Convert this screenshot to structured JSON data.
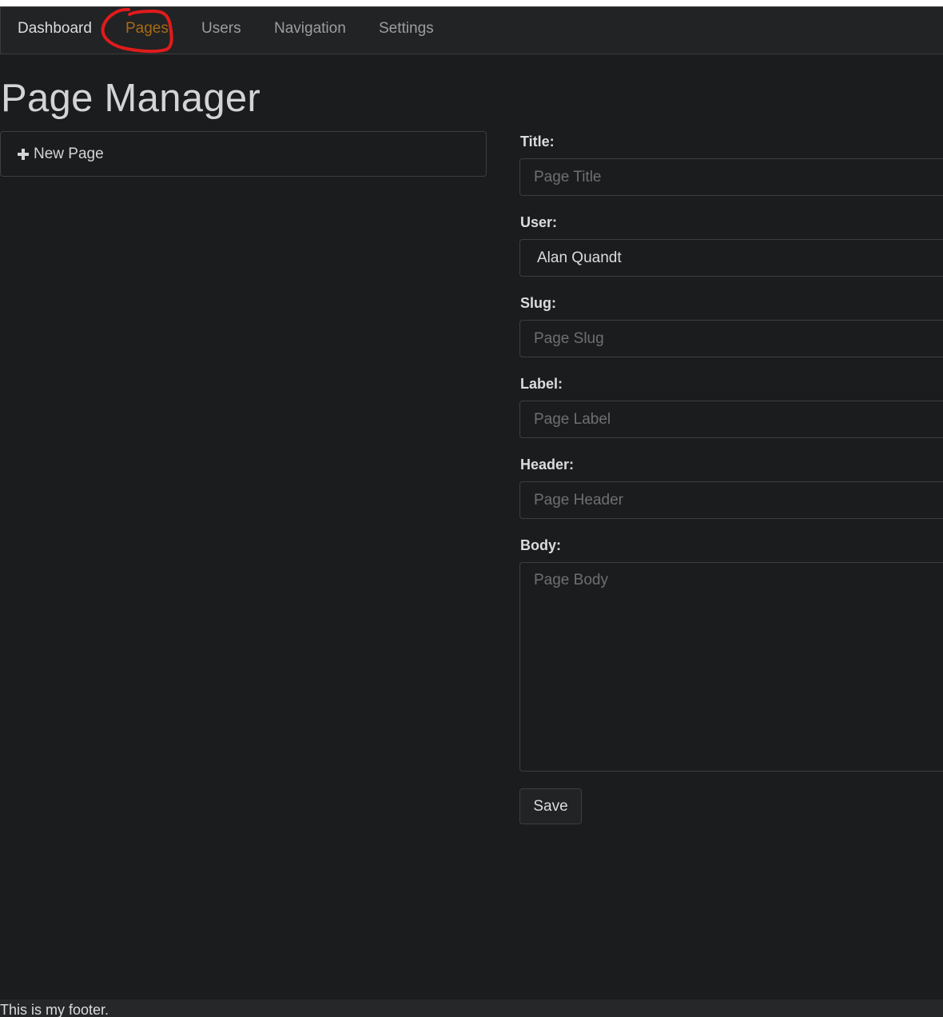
{
  "navbar": {
    "brand": "Dashboard",
    "items": [
      {
        "label": "Pages",
        "active": true
      },
      {
        "label": "Users"
      },
      {
        "label": "Navigation"
      },
      {
        "label": "Settings"
      }
    ],
    "active_color": "#a86a14",
    "annotation_color": "#e01b1b"
  },
  "main": {
    "title": "Page Manager",
    "new_page_label": "New Page"
  },
  "form": {
    "title_label": "Title:",
    "title_placeholder": "Page Title",
    "title_value": "",
    "user_label": "User:",
    "user_selected": "Alan Quandt",
    "slug_label": "Slug:",
    "slug_placeholder": "Page Slug",
    "slug_value": "",
    "label_label": "Label:",
    "label_placeholder": "Page Label",
    "label_value": "",
    "header_label": "Header:",
    "header_placeholder": "Page Header",
    "header_value": "",
    "body_label": "Body:",
    "body_placeholder": "Page Body",
    "body_value": "",
    "save_label": "Save"
  },
  "footer": {
    "text": "This is my footer."
  }
}
